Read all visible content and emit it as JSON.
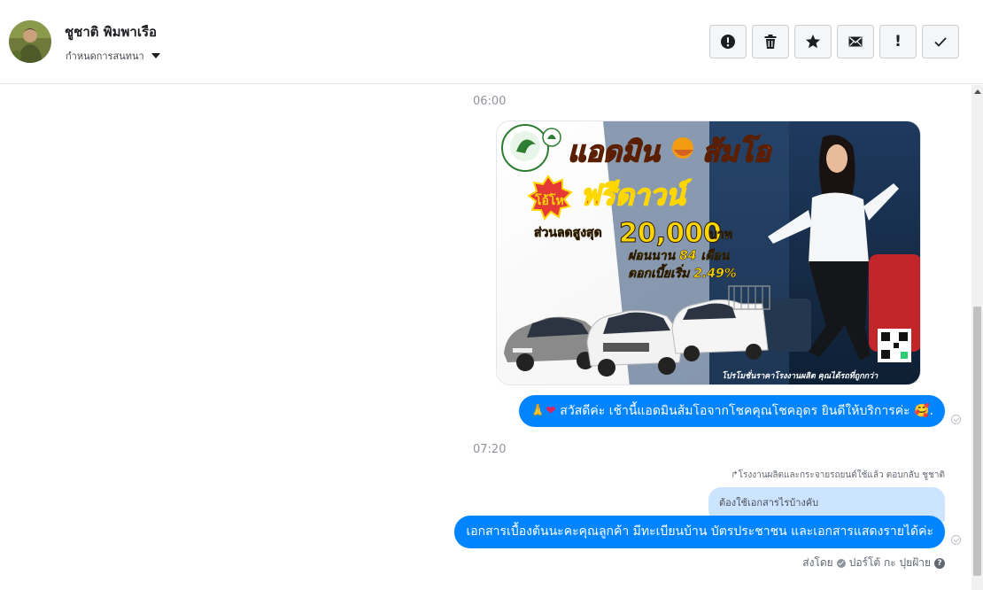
{
  "header": {
    "contact_name": "ชูชาติ พิมพาเรือ",
    "assign_label": "กำหนดการสนทนา",
    "actions": [
      {
        "name": "mark-spam-button",
        "icon": "alert-circle-icon"
      },
      {
        "name": "delete-button",
        "icon": "trash-icon"
      },
      {
        "name": "star-button",
        "icon": "star-icon"
      },
      {
        "name": "mark-unread-button",
        "icon": "envelope-icon"
      },
      {
        "name": "follow-up-button",
        "icon": "exclamation-icon",
        "glyph": "!"
      },
      {
        "name": "mark-done-button",
        "icon": "check-icon"
      }
    ]
  },
  "thread": {
    "timestamp_1": "06:00",
    "timestamp_2": "07:20",
    "ad": {
      "title_left": "แอดมิน",
      "title_right": "ส้มโอ",
      "badge": "โอ้โห",
      "headline": "ฟรีดาวน์",
      "discount_label": "ส่วนลดสูงสุด",
      "discount_amount": "20,000",
      "discount_unit": "บาท",
      "installment": "ผ่อนนาน 84 เดือน",
      "interest": "ดอกเบี้ยเริ่ม 2.49%",
      "footer": "โปรโมชั่นราคาโรงงานผลิต คุณได้รถที่ถูกกว่า"
    },
    "message_1_prefix": "🙏",
    "message_1_heart": "❤",
    "message_1_text": " สวัสดีค่ะ เช้านี้แอดมินส้มโอจากโชคคุณโชคอุดร ยินดีให้บริการค่ะ ",
    "message_1_suffix": "🥰.",
    "reply_note": "↱โรงงานผลิตและกระจายรถยนต์ใช้แล้ว ตอบกลับ ชูชาติ",
    "quoted_message": "ต้องใช้เอกสารไรบ้างคับ",
    "message_2": "เอกสารเบื้องต้นนะคะคุณลูกค้า มีทะเบียนบ้าน บัตรประชาชน และเอกสารแสดงรายได้ค่ะ",
    "sent_by_label": "ส่งโดย",
    "sent_by_name": "ปอร์โต้ กะ ปุยฝ้าย",
    "help_glyph": "?"
  },
  "colors": {
    "bubble": "#0084ff",
    "quoted_bubble": "#cce4ff",
    "header_border": "#dadde1",
    "ad_title_orange": "#ff6a00",
    "ad_yellow": "#ffd700"
  }
}
